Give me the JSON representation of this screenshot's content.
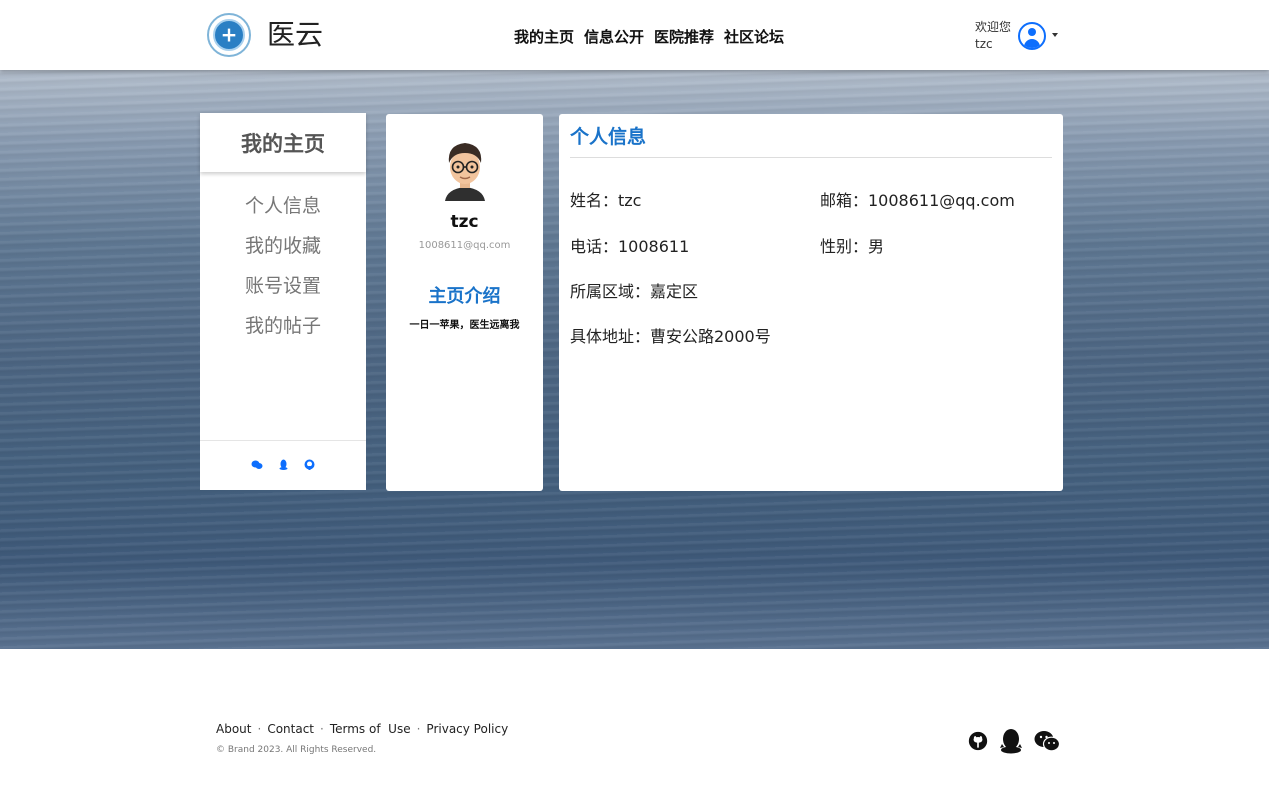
{
  "header": {
    "brand": "医云",
    "nav": [
      "我的主页",
      "信息公开",
      "医院推荐",
      "社区论坛"
    ],
    "welcome": "欢迎您",
    "username": "tzc"
  },
  "menu": {
    "title": "我的主页",
    "items": [
      "个人信息",
      "我的收藏",
      "账号设置",
      "我的帖子"
    ],
    "footer_icons": [
      "wechat-icon",
      "qq-icon",
      "github-icon"
    ]
  },
  "profile": {
    "name": "tzc",
    "email": "1008611@qq.com",
    "intro_title": "主页介绍",
    "intro_text": "一日一苹果，医生远离我"
  },
  "info": {
    "title": "个人信息",
    "name": "姓名：tzc",
    "email": "邮箱：1008611@qq.com",
    "phone": "电话：1008611",
    "gender": "性别：男",
    "district": "所属区域：嘉定区",
    "address": "具体地址：曹安公路2000号"
  },
  "footer": {
    "links": [
      "About",
      "Contact",
      "Terms of  Use",
      "Privacy Policy"
    ],
    "copyright": "© Brand 2023. All Rights Reserved.",
    "social_icons": [
      "github-icon",
      "qq-icon",
      "wechat-icon"
    ]
  },
  "colors": {
    "accent": "#1a73c9",
    "link_blue": "#0d6efd"
  }
}
